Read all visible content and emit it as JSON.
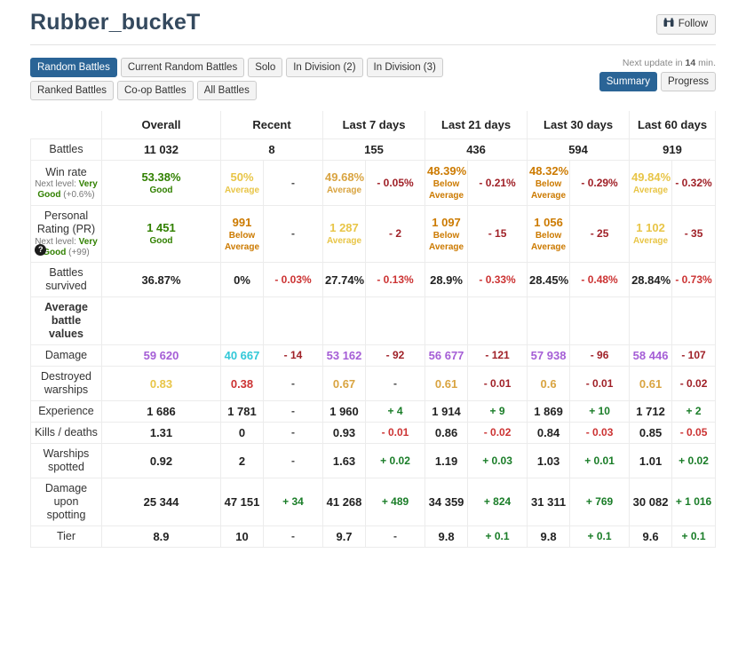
{
  "header": {
    "player_name": "Rubber_buckeT",
    "follow_label": "Follow",
    "follow_icon": "binoculars-icon"
  },
  "controls": {
    "mode_tabs": [
      {
        "label": "Random Battles",
        "active": true
      },
      {
        "label": "Current Random Battles",
        "active": false
      },
      {
        "label": "Solo",
        "active": false
      },
      {
        "label": "In Division (2)",
        "active": false
      },
      {
        "label": "In Division (3)",
        "active": false
      },
      {
        "label": "Ranked Battles",
        "active": false
      },
      {
        "label": "Co-op Battles",
        "active": false
      },
      {
        "label": "All Battles",
        "active": false
      }
    ],
    "next_update_prefix": "Next update in ",
    "next_update_value": "14",
    "next_update_suffix": " min.",
    "view_tabs": [
      {
        "label": "Summary",
        "active": true
      },
      {
        "label": "Progress",
        "active": false
      }
    ]
  },
  "table": {
    "columns": [
      "",
      "Overall",
      "Recent",
      "Last 7 days",
      "Last 21 days",
      "Last 30 days",
      "Last 60 days"
    ],
    "rows": [
      {
        "label": "Battles",
        "cells": [
          {
            "value": "11 032",
            "color": "c-black"
          },
          {
            "value": "8",
            "color": "c-black",
            "delta": "",
            "span2": true
          },
          {
            "value": "155",
            "color": "c-black",
            "delta": "",
            "span2": true
          },
          {
            "value": "436",
            "color": "c-black",
            "delta": "",
            "span2": true
          },
          {
            "value": "594",
            "color": "c-black",
            "delta": "",
            "span2": true
          },
          {
            "value": "919",
            "color": "c-black",
            "delta": "",
            "span2": true
          }
        ]
      },
      {
        "label": "Win rate",
        "next_level_prefix": "Next level: ",
        "next_level_name": "Very Good",
        "next_level_amount": " (+0.6%)",
        "next_level_color": "c-green",
        "cells": [
          {
            "value": "53.38%",
            "color": "c-green",
            "grade": "Good",
            "grade_color": "c-green"
          },
          {
            "value": "50%",
            "color": "c-yellow",
            "grade": "Average",
            "grade_color": "c-yellow",
            "delta": "-",
            "delta_color": "dash"
          },
          {
            "value": "49.68%",
            "color": "c-gold",
            "grade": "Average",
            "grade_color": "c-gold",
            "delta": "- 0.05%",
            "delta_color": "c-darkred"
          },
          {
            "value": "48.39%",
            "color": "c-orange",
            "grade": "Below Average",
            "grade_color": "c-orange",
            "delta": "- 0.21%",
            "delta_color": "c-darkred"
          },
          {
            "value": "48.32%",
            "color": "c-orange",
            "grade": "Below Average",
            "grade_color": "c-orange",
            "delta": "- 0.29%",
            "delta_color": "c-darkred"
          },
          {
            "value": "49.84%",
            "color": "c-yellow",
            "grade": "Average",
            "grade_color": "c-yellow",
            "delta": "- 0.32%",
            "delta_color": "c-darkred"
          }
        ]
      },
      {
        "label": "Personal Rating (PR)",
        "help_icon": "question-mark-icon",
        "next_level_prefix": "Next level: ",
        "next_level_name": "Very Good",
        "next_level_amount": " (+99)",
        "next_level_color": "c-green",
        "cells": [
          {
            "value": "1 451",
            "color": "c-green",
            "grade": "Good",
            "grade_color": "c-green"
          },
          {
            "value": "991",
            "color": "c-orange",
            "grade": "Below Average",
            "grade_color": "c-orange",
            "delta": "-",
            "delta_color": "dash"
          },
          {
            "value": "1 287",
            "color": "c-yellow",
            "grade": "Average",
            "grade_color": "c-yellow",
            "delta": "- 2",
            "delta_color": "c-darkred"
          },
          {
            "value": "1 097",
            "color": "c-orange",
            "grade": "Below Average",
            "grade_color": "c-orange",
            "delta": "- 15",
            "delta_color": "c-darkred"
          },
          {
            "value": "1 056",
            "color": "c-orange",
            "grade": "Below Average",
            "grade_color": "c-orange",
            "delta": "- 25",
            "delta_color": "c-darkred"
          },
          {
            "value": "1 102",
            "color": "c-yellow",
            "grade": "Average",
            "grade_color": "c-yellow",
            "delta": "- 35",
            "delta_color": "c-darkred"
          }
        ]
      },
      {
        "label": "Battles survived",
        "cells": [
          {
            "value": "36.87%",
            "color": "c-black"
          },
          {
            "value": "0%",
            "color": "c-black",
            "delta": "- 0.03%",
            "delta_color": "c-red"
          },
          {
            "value": "27.74%",
            "color": "c-black",
            "delta": "- 0.13%",
            "delta_color": "c-red"
          },
          {
            "value": "28.9%",
            "color": "c-black",
            "delta": "- 0.33%",
            "delta_color": "c-red"
          },
          {
            "value": "28.45%",
            "color": "c-black",
            "delta": "- 0.48%",
            "delta_color": "c-red"
          },
          {
            "value": "28.84%",
            "color": "c-black",
            "delta": "- 0.73%",
            "delta_color": "c-red"
          }
        ]
      },
      {
        "label": "Average battle values",
        "section": true,
        "cells": [
          {
            "value": "",
            "color": "c-black"
          },
          {
            "value": "",
            "color": "c-black",
            "delta": ""
          },
          {
            "value": "",
            "color": "c-black",
            "delta": ""
          },
          {
            "value": "",
            "color": "c-black",
            "delta": ""
          },
          {
            "value": "",
            "color": "c-black",
            "delta": ""
          },
          {
            "value": "",
            "color": "c-black",
            "delta": ""
          }
        ]
      },
      {
        "label": "Damage",
        "cells": [
          {
            "value": "59 620",
            "color": "c-purple"
          },
          {
            "value": "40 667",
            "color": "c-cyan",
            "delta": "- 14",
            "delta_color": "c-darkred"
          },
          {
            "value": "53 162",
            "color": "c-purple",
            "delta": "- 92",
            "delta_color": "c-darkred"
          },
          {
            "value": "56 677",
            "color": "c-purple",
            "delta": "- 121",
            "delta_color": "c-darkred"
          },
          {
            "value": "57 938",
            "color": "c-purple",
            "delta": "- 96",
            "delta_color": "c-darkred"
          },
          {
            "value": "58 446",
            "color": "c-purple",
            "delta": "- 107",
            "delta_color": "c-darkred"
          }
        ]
      },
      {
        "label": "Destroyed warships",
        "cells": [
          {
            "value": "0.83",
            "color": "c-yellow"
          },
          {
            "value": "0.38",
            "color": "c-red",
            "delta": "-",
            "delta_color": "dash"
          },
          {
            "value": "0.67",
            "color": "c-gold",
            "delta": "-",
            "delta_color": "dash"
          },
          {
            "value": "0.61",
            "color": "c-gold",
            "delta": "- 0.01",
            "delta_color": "c-darkred"
          },
          {
            "value": "0.6",
            "color": "c-gold",
            "delta": "- 0.01",
            "delta_color": "c-darkred"
          },
          {
            "value": "0.61",
            "color": "c-gold",
            "delta": "- 0.02",
            "delta_color": "c-darkred"
          }
        ]
      },
      {
        "label": "Experience",
        "cells": [
          {
            "value": "1 686",
            "color": "c-black"
          },
          {
            "value": "1 781",
            "color": "c-black",
            "delta": "-",
            "delta_color": "dash"
          },
          {
            "value": "1 960",
            "color": "c-black",
            "delta": "+ 4",
            "delta_color": "c-dgreen"
          },
          {
            "value": "1 914",
            "color": "c-black",
            "delta": "+ 9",
            "delta_color": "c-dgreen"
          },
          {
            "value": "1 869",
            "color": "c-black",
            "delta": "+ 10",
            "delta_color": "c-dgreen"
          },
          {
            "value": "1 712",
            "color": "c-black",
            "delta": "+ 2",
            "delta_color": "c-dgreen"
          }
        ]
      },
      {
        "label": "Kills / deaths",
        "cells": [
          {
            "value": "1.31",
            "color": "c-black"
          },
          {
            "value": "0",
            "color": "c-black",
            "delta": "-",
            "delta_color": "dash"
          },
          {
            "value": "0.93",
            "color": "c-black",
            "delta": "- 0.01",
            "delta_color": "c-red"
          },
          {
            "value": "0.86",
            "color": "c-black",
            "delta": "- 0.02",
            "delta_color": "c-red"
          },
          {
            "value": "0.84",
            "color": "c-black",
            "delta": "- 0.03",
            "delta_color": "c-red"
          },
          {
            "value": "0.85",
            "color": "c-black",
            "delta": "- 0.05",
            "delta_color": "c-red"
          }
        ]
      },
      {
        "label": "Warships spotted",
        "cells": [
          {
            "value": "0.92",
            "color": "c-black"
          },
          {
            "value": "2",
            "color": "c-black",
            "delta": "-",
            "delta_color": "dash"
          },
          {
            "value": "1.63",
            "color": "c-black",
            "delta": "+ 0.02",
            "delta_color": "c-dgreen"
          },
          {
            "value": "1.19",
            "color": "c-black",
            "delta": "+ 0.03",
            "delta_color": "c-dgreen"
          },
          {
            "value": "1.03",
            "color": "c-black",
            "delta": "+ 0.01",
            "delta_color": "c-dgreen"
          },
          {
            "value": "1.01",
            "color": "c-black",
            "delta": "+ 0.02",
            "delta_color": "c-dgreen"
          }
        ]
      },
      {
        "label": "Damage upon spotting",
        "cells": [
          {
            "value": "25 344",
            "color": "c-black"
          },
          {
            "value": "47 151",
            "color": "c-black",
            "delta": "+ 34",
            "delta_color": "c-dgreen"
          },
          {
            "value": "41 268",
            "color": "c-black",
            "delta": "+ 489",
            "delta_color": "c-dgreen"
          },
          {
            "value": "34 359",
            "color": "c-black",
            "delta": "+ 824",
            "delta_color": "c-dgreen"
          },
          {
            "value": "31 311",
            "color": "c-black",
            "delta": "+ 769",
            "delta_color": "c-dgreen"
          },
          {
            "value": "30 082",
            "color": "c-black",
            "delta": "+ 1 016",
            "delta_color": "c-dgreen"
          }
        ]
      },
      {
        "label": "Tier",
        "cells": [
          {
            "value": "8.9",
            "color": "c-black"
          },
          {
            "value": "10",
            "color": "c-black",
            "delta": "-",
            "delta_color": "dash"
          },
          {
            "value": "9.7",
            "color": "c-black",
            "delta": "-",
            "delta_color": "dash"
          },
          {
            "value": "9.8",
            "color": "c-black",
            "delta": "+ 0.1",
            "delta_color": "c-dgreen"
          },
          {
            "value": "9.8",
            "color": "c-black",
            "delta": "+ 0.1",
            "delta_color": "c-dgreen"
          },
          {
            "value": "9.6",
            "color": "c-black",
            "delta": "+ 0.1",
            "delta_color": "c-dgreen"
          }
        ]
      }
    ]
  }
}
